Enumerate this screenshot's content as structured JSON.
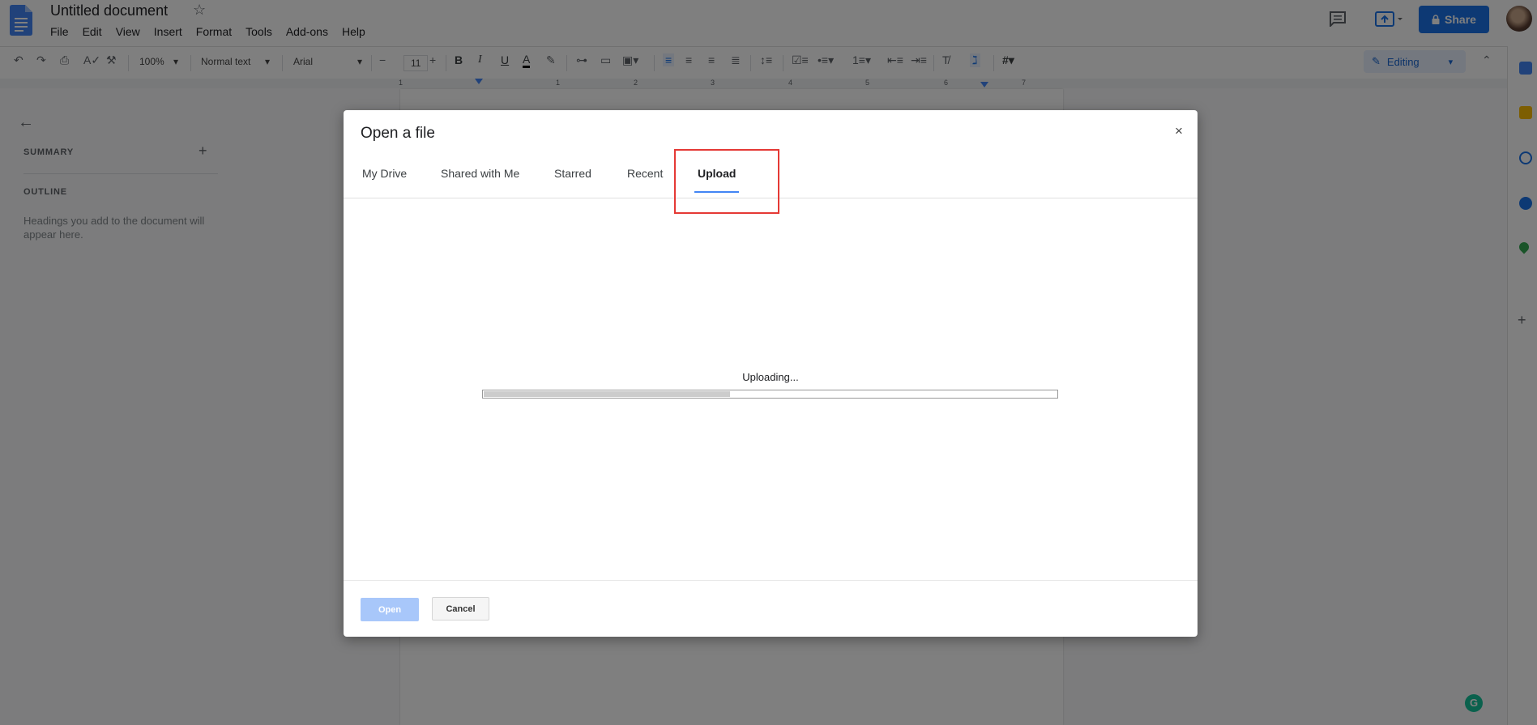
{
  "doc": {
    "title": "Untitled document",
    "menu": [
      "File",
      "Edit",
      "View",
      "Insert",
      "Format",
      "Tools",
      "Add-ons",
      "Help"
    ],
    "share_label": "Share"
  },
  "toolbar": {
    "zoom": "100%",
    "style": "Normal text",
    "font": "Arial",
    "font_size": "11",
    "mode": "Editing"
  },
  "ruler": {
    "numbers": [
      "1",
      "1",
      "2",
      "3",
      "4",
      "5",
      "6",
      "7"
    ]
  },
  "sidebar": {
    "summary_label": "SUMMARY",
    "outline_label": "OUTLINE",
    "outline_hint": "Headings you add to the document will appear here."
  },
  "dialog": {
    "title": "Open a file",
    "close_glyph": "×",
    "tabs": [
      {
        "label": "My Drive"
      },
      {
        "label": "Shared with Me"
      },
      {
        "label": "Starred"
      },
      {
        "label": "Recent"
      },
      {
        "label": "Upload",
        "active": true
      }
    ],
    "upload_status": "Uploading...",
    "upload_progress": 0.43,
    "open_label": "Open",
    "cancel_label": "Cancel"
  },
  "colors": {
    "accent": "#1a73e8",
    "highlight": "#e53935",
    "tab_underline": "#4285f4"
  },
  "icons": [
    "docs-logo-icon",
    "star-icon",
    "comment-icon",
    "present-icon",
    "lock-icon",
    "undo-icon",
    "redo-icon",
    "print-icon",
    "spellcheck-icon",
    "paint-format-icon",
    "bold-icon",
    "italic-icon",
    "underline-icon",
    "text-color-icon",
    "highlight-icon",
    "link-icon",
    "comment-add-icon",
    "image-icon",
    "align-left-icon",
    "align-center-icon",
    "align-right-icon",
    "justify-icon",
    "line-spacing-icon",
    "checklist-icon",
    "bulleted-list-icon",
    "numbered-list-icon",
    "indent-decrease-icon",
    "indent-increase-icon",
    "clear-format-icon",
    "pencil-icon",
    "back-arrow-icon",
    "plus-icon",
    "close-icon"
  ]
}
